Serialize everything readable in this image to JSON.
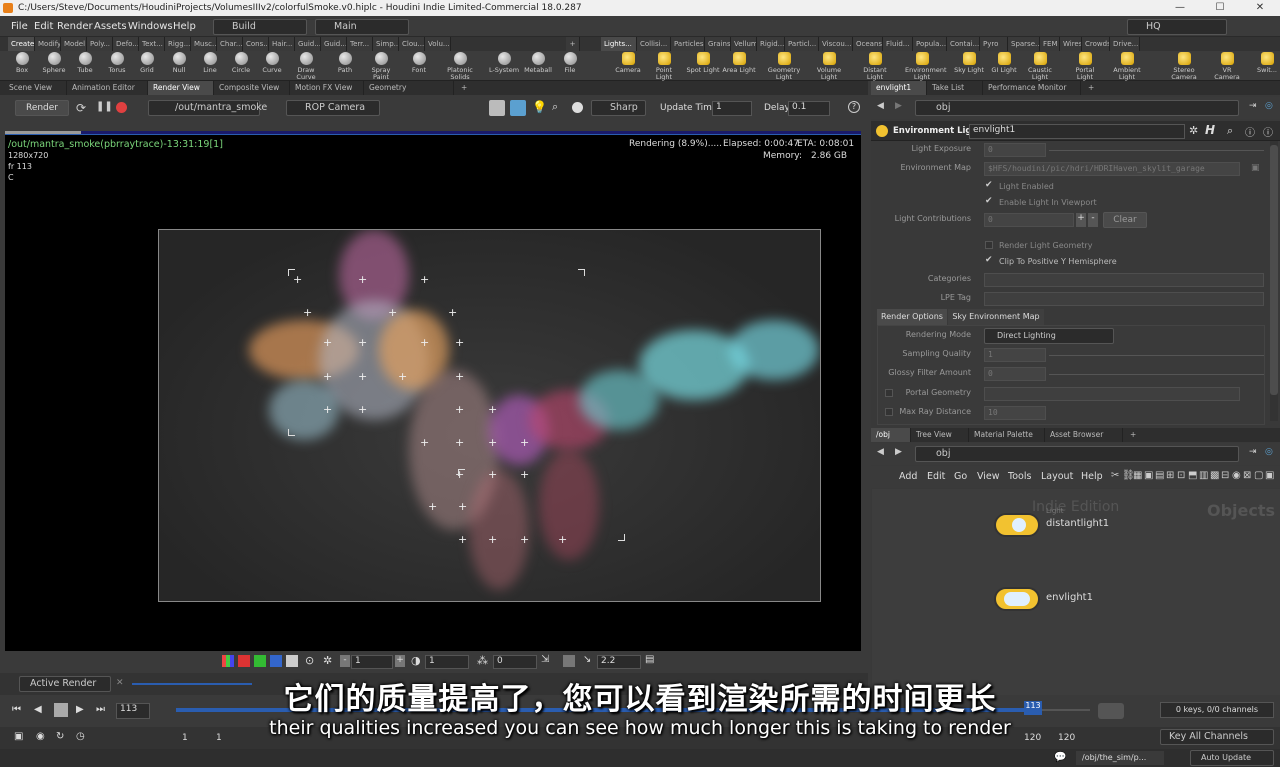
{
  "window": {
    "title": "C:/Users/Steve/Documents/HoudiniProjects/VolumesIIIv2/colorfulSmoke.v0.hiplc - Houdini Indie Limited-Commercial 18.0.287",
    "minimize": "—",
    "maximize": "☐",
    "close": "✕"
  },
  "menu": [
    "File",
    "Edit",
    "Render",
    "Assets",
    "Windows",
    "Help"
  ],
  "desktop_select": "Build",
  "network_select": "Main",
  "hq_select": "HQ",
  "shelf_tabs_left": [
    "Create",
    "Modify",
    "Model",
    "Poly...",
    "Defo...",
    "Text...",
    "Rigg...",
    "Musc...",
    "Char...",
    "Cons...",
    "Hair...",
    "Guid...",
    "Guid...",
    "Terr...",
    "Simp...",
    "Clou...",
    "Volu..."
  ],
  "shelf_tabs_right": [
    "Lights...",
    "Collisi...",
    "Particles",
    "Grains",
    "Vellum",
    "Rigid...",
    "Particl...",
    "Viscou...",
    "Oceans",
    "Fluid...",
    "Popula...",
    "Contai...",
    "Pyro FX",
    "Sparse...",
    "FEM",
    "Wires",
    "Crowds",
    "Drive..."
  ],
  "tools_left": [
    "Box",
    "Sphere",
    "Tube",
    "Torus",
    "Grid",
    "Null",
    "Line",
    "Circle",
    "Curve",
    "Draw Curve",
    "Path",
    "Spray Paint",
    "Font",
    "Platonic Solids",
    "L-System",
    "Metaball",
    "File"
  ],
  "tools_right": [
    "Camera",
    "Point Light",
    "Spot Light",
    "Area Light",
    "Geometry Light",
    "Volume Light",
    "Distant Light",
    "Environment Light",
    "Sky Light",
    "GI Light",
    "Caustic Light",
    "Portal Light",
    "Ambient Light",
    "Stereo Camera",
    "VR Camera",
    "Swit..."
  ],
  "left_panel_tabs": [
    "Scene View",
    "Animation Editor",
    "Render View",
    "Composite View",
    "Motion FX View",
    "Geometry Spreadsheet"
  ],
  "render_toolbar": {
    "render_label": "Render",
    "rop_path": "/out/mantra_smoke",
    "camera": "ROP Camera",
    "sharp": "Sharp",
    "update_time_label": "Update Time",
    "update_time_value": "1",
    "delay_label": "Delay",
    "delay_value": "0.1"
  },
  "viewer": {
    "path_title": "/out/mantra_smoke(pbrraytrace)-13:31:19[1]",
    "resolution": "1280x720",
    "frame": "fr 113",
    "channel": "C",
    "status": "Rendering (8.9%).....",
    "elapsed": "Elapsed: 0:00:47",
    "eta": "ETA: 0:08:01",
    "memory_label": "Memory:",
    "memory_value": "2.86 GB",
    "render_progress": 0.089
  },
  "viewer_bottom": {
    "field1": "1",
    "field2": "1",
    "field3": "0",
    "gamma": "2.2"
  },
  "active_render": "Active Render",
  "timeline": {
    "frame": "113",
    "start": "1",
    "start2": "1",
    "end": "120",
    "end2": "120",
    "marker": "113",
    "progress": 0.94
  },
  "keys_status": "0 keys, 0/0 channels",
  "key_all_channels": "Key All Channels",
  "auto_update": "Auto Update",
  "status_path": "/obj/the_sim/p...",
  "right_top_tabs": [
    "envlight1",
    "Take List",
    "Performance Monitor"
  ],
  "param_path": "obj",
  "param_header": {
    "type": "Environment Light",
    "name": "envlight1"
  },
  "params": {
    "light_exposure_label": "Light Exposure",
    "light_exposure_value": "0",
    "env_map_label": "Environment Map",
    "env_map_value": "$HFS/houdini/pic/hdri/HDRIHaven_skylit_garage",
    "light_enabled": "Light Enabled",
    "enable_in_viewport": "Enable Light In Viewport",
    "contrib_label": "Light Contributions",
    "contrib_value": "0",
    "clear": "Clear",
    "render_geom": "Render Light Geometry",
    "clip_hemi": "Clip To Positive Y Hemisphere",
    "categories_label": "Categories",
    "lpe_label": "LPE Tag",
    "tab_render_options": "Render Options",
    "tab_sky_env": "Sky Environment Map",
    "rendering_mode_label": "Rendering Mode",
    "rendering_mode_value": "Direct Lighting",
    "sampling_label": "Sampling Quality",
    "sampling_value": "1",
    "glossy_label": "Glossy Filter Amount",
    "glossy_value": "0",
    "portal_label": "Portal Geometry",
    "maxray_label": "Max Ray Distance",
    "maxray_value": "10"
  },
  "network_tabs": [
    "/obj",
    "Tree View",
    "Material Palette",
    "Asset Browser"
  ],
  "network_path": "obj",
  "network_menu": [
    "Add",
    "Edit",
    "Go",
    "View",
    "Tools",
    "Layout",
    "Help"
  ],
  "network": {
    "watermark": "Indie Edition",
    "context": "Objects",
    "node1_type": "Light",
    "node1_name": "distantlight1",
    "node2_name": "envlight1"
  },
  "subtitles": {
    "zh": "它们的质量提高了，您可以看到渲染所需的时间更长",
    "en": "their qualities increased you can see how much longer this is taking to render"
  },
  "colors": {
    "accent_blue": "#2a5db0",
    "node_yellow": "#f2c230",
    "viewer_green": "#7bd67b"
  }
}
